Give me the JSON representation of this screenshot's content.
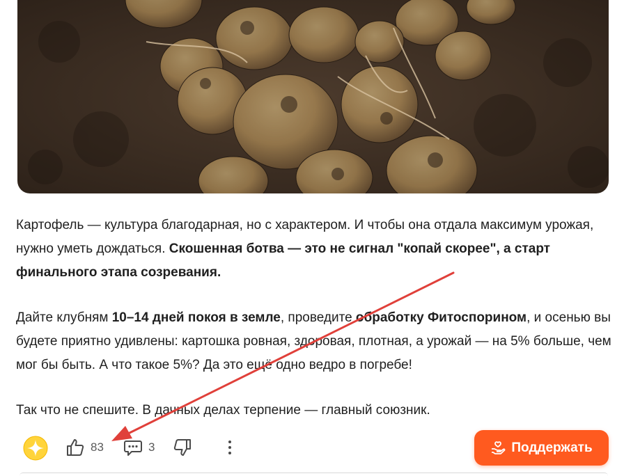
{
  "photo": {
    "alt_icon": "potatoes-photo"
  },
  "article": {
    "p1_text1": "Картофель — культура благодарная, но с характером. И чтобы она отдала максимум урожая, нужно уметь дождаться. ",
    "p1_bold": "Скошенная ботва — это не сигнал \"копай скорее\", а старт финального этапа созревания.",
    "p2_text1": "Дайте клубням ",
    "p2_bold1": "10–14 дней покоя в земле",
    "p2_text2": ", проведите ",
    "p2_bold2": "обработку Фитоспорином",
    "p2_text3": ", и осенью вы будете приятно удивлены: картошка ровная, здоровая, плотная, а урожай — на 5% больше, чем мог бы быть. А что такое 5%? Да это ещё одно ведро в погребе!",
    "p3_text": "Так что не спешите. В дачных делах терпение — главный союзник."
  },
  "actions": {
    "likes": "83",
    "comments": "3",
    "support_label": "Поддержать"
  },
  "colors": {
    "accent": "#ff5a1f",
    "annotation_arrow": "#e0403a"
  }
}
